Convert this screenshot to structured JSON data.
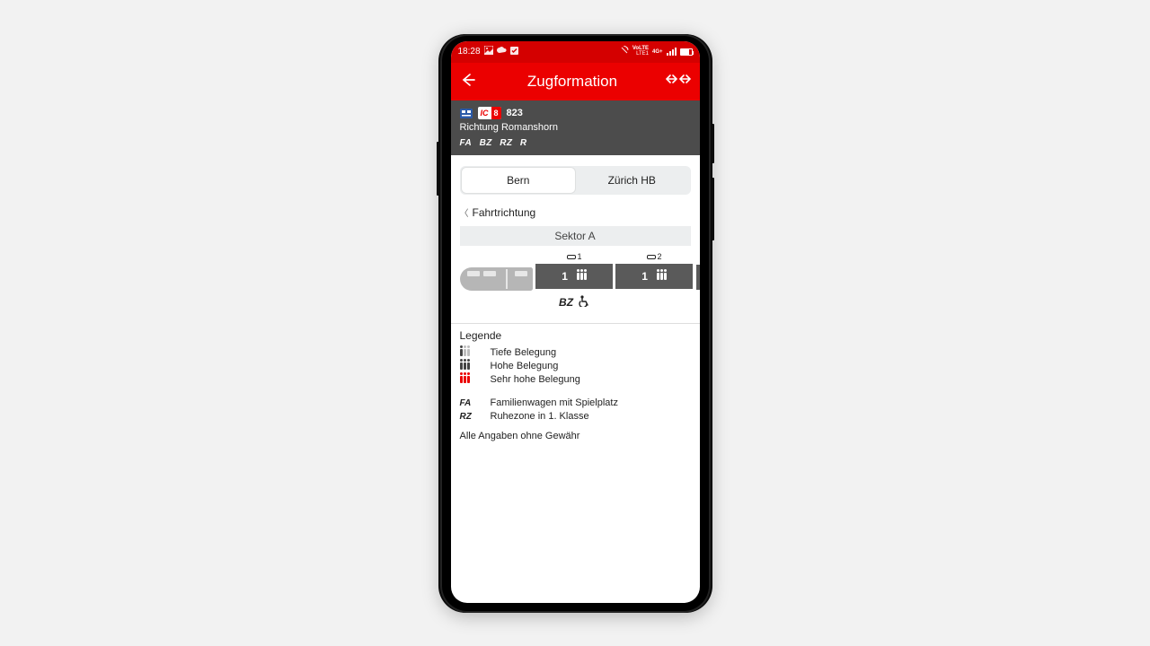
{
  "status": {
    "time": "18:28",
    "lte": "LTE1",
    "net": "4G+"
  },
  "appbar": {
    "title": "Zugformation"
  },
  "train": {
    "category_letters": "IC",
    "line": "8",
    "number": "823",
    "direction_label": "Richtung Romanshorn",
    "features": [
      "FA",
      "BZ",
      "RZ",
      "R"
    ]
  },
  "tabs": [
    {
      "label": "Bern",
      "selected": true
    },
    {
      "label": "Zürich HB",
      "selected": false
    }
  ],
  "direction_hint": "Fahrtrichtung",
  "sector": "Sektor A",
  "cars": [
    {
      "num": "1",
      "class": "1",
      "occupancy": "low",
      "under": {
        "abbr": "BZ",
        "wheelchair": true
      }
    },
    {
      "num": "2",
      "class": "1",
      "occupancy": "low",
      "under": {}
    }
  ],
  "legend": {
    "title": "Legende",
    "occupancy": [
      {
        "level": "low",
        "text": "Tiefe Belegung"
      },
      {
        "level": "high",
        "text": "Hohe Belegung"
      },
      {
        "level": "vhigh",
        "text": "Sehr hohe Belegung"
      }
    ],
    "abbrev": [
      {
        "key": "FA",
        "text": "Familienwagen mit Spielplatz"
      },
      {
        "key": "RZ",
        "text": "Ruhezone in 1. Klasse"
      }
    ],
    "disclaimer": "Alle Angaben ohne Gewähr"
  }
}
